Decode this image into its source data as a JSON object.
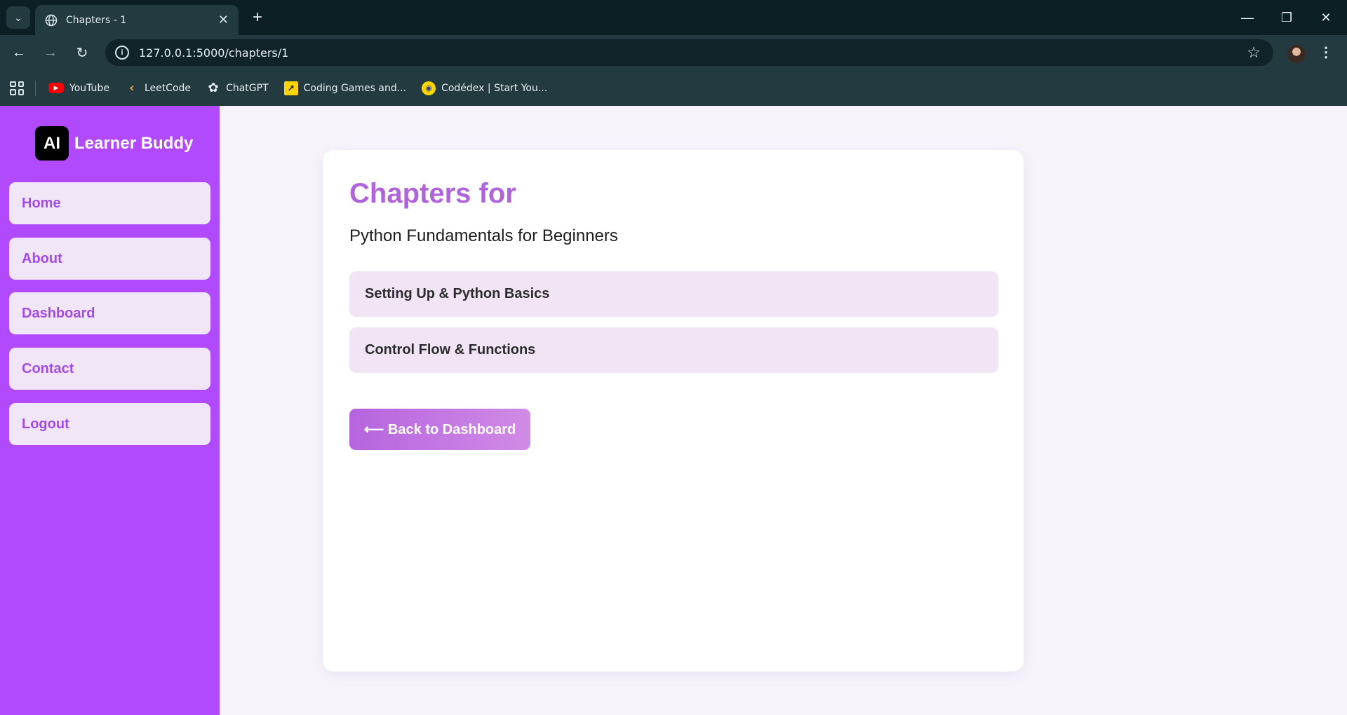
{
  "browser": {
    "tab_title": "Chapters - 1",
    "url": "127.0.0.1:5000/chapters/1",
    "bookmarks": [
      {
        "label": "YouTube",
        "icon": "youtube-icon"
      },
      {
        "label": "LeetCode",
        "icon": "leetcode-icon"
      },
      {
        "label": "ChatGPT",
        "icon": "chatgpt-icon"
      },
      {
        "label": "Coding Games and...",
        "icon": "coding-games-icon"
      },
      {
        "label": "Codédex | Start You...",
        "icon": "codedex-icon"
      }
    ]
  },
  "sidebar": {
    "logo_text": "AI",
    "brand_name": "Learner Buddy",
    "items": [
      {
        "label": "Home"
      },
      {
        "label": "About"
      },
      {
        "label": "Dashboard"
      },
      {
        "label": "Contact"
      },
      {
        "label": "Logout"
      }
    ]
  },
  "main": {
    "title": "Chapters for",
    "course_name": "Python Fundamentals for Beginners",
    "chapters": [
      {
        "label": "Setting Up & Python Basics"
      },
      {
        "label": "Control Flow & Functions"
      }
    ],
    "back_button": "⟵ Back to Dashboard"
  },
  "colors": {
    "sidebar_bg": "#b149fd",
    "nav_item_bg": "#f1e6f8",
    "accent_text": "#a34bea",
    "title_color": "#b064dc",
    "chapter_bg": "#f1e4f5",
    "chrome_bg": "#233a40"
  }
}
